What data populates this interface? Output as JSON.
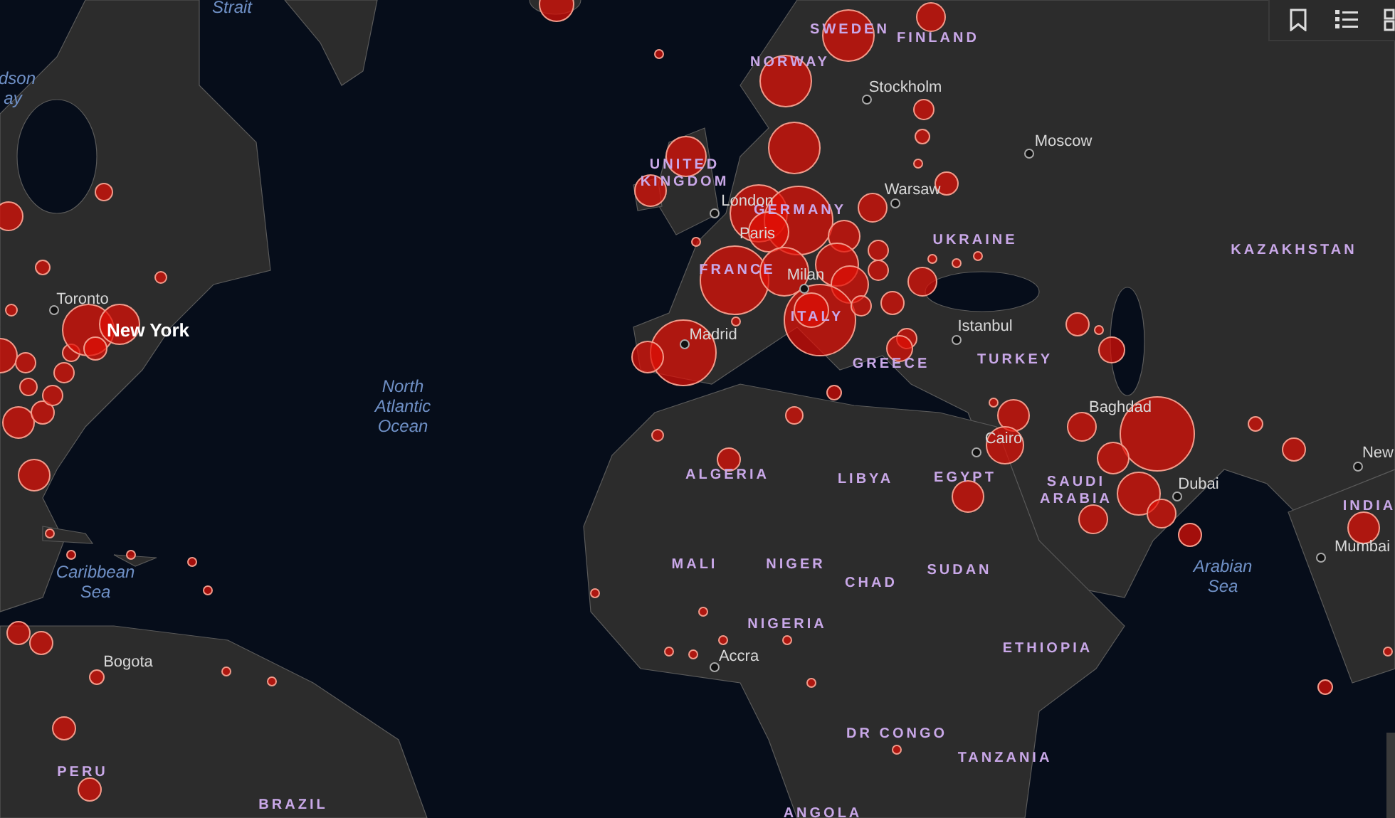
{
  "map": {
    "water_labels": [
      "Strait",
      "dson",
      "ay",
      "North Atlantic Ocean",
      "Caribbean Sea",
      "Arabian Sea"
    ],
    "country_labels": [
      "SWEDEN",
      "FINLAND",
      "NORWAY",
      "UNITED KINGDOM",
      "GERMANY",
      "FRANCE",
      "ITALY",
      "GREECE",
      "UKRAINE",
      "KAZAKHSTAN",
      "TURKEY",
      "ALGERIA",
      "LIBYA",
      "EGYPT",
      "SAUDI ARABIA",
      "INDIA",
      "MALI",
      "NIGER",
      "CHAD",
      "SUDAN",
      "NIGERIA",
      "ETHIOPIA",
      "DR CONGO",
      "TANZANIA",
      "ANGOLA",
      "PERU",
      "BRAZIL"
    ],
    "city_labels": [
      "Toronto",
      "New York",
      "Stockholm",
      "Moscow",
      "London",
      "Paris",
      "Milan",
      "Madrid",
      "Warsaw",
      "Istanbul",
      "Baghdad",
      "Cairo",
      "Dubai",
      "Mumbai",
      "New",
      "Bogota",
      "Accra"
    ]
  },
  "toolbar": {
    "buttons": [
      {
        "kind": "bookmarks"
      },
      {
        "kind": "legend"
      },
      {
        "kind": "basemap"
      }
    ]
  }
}
